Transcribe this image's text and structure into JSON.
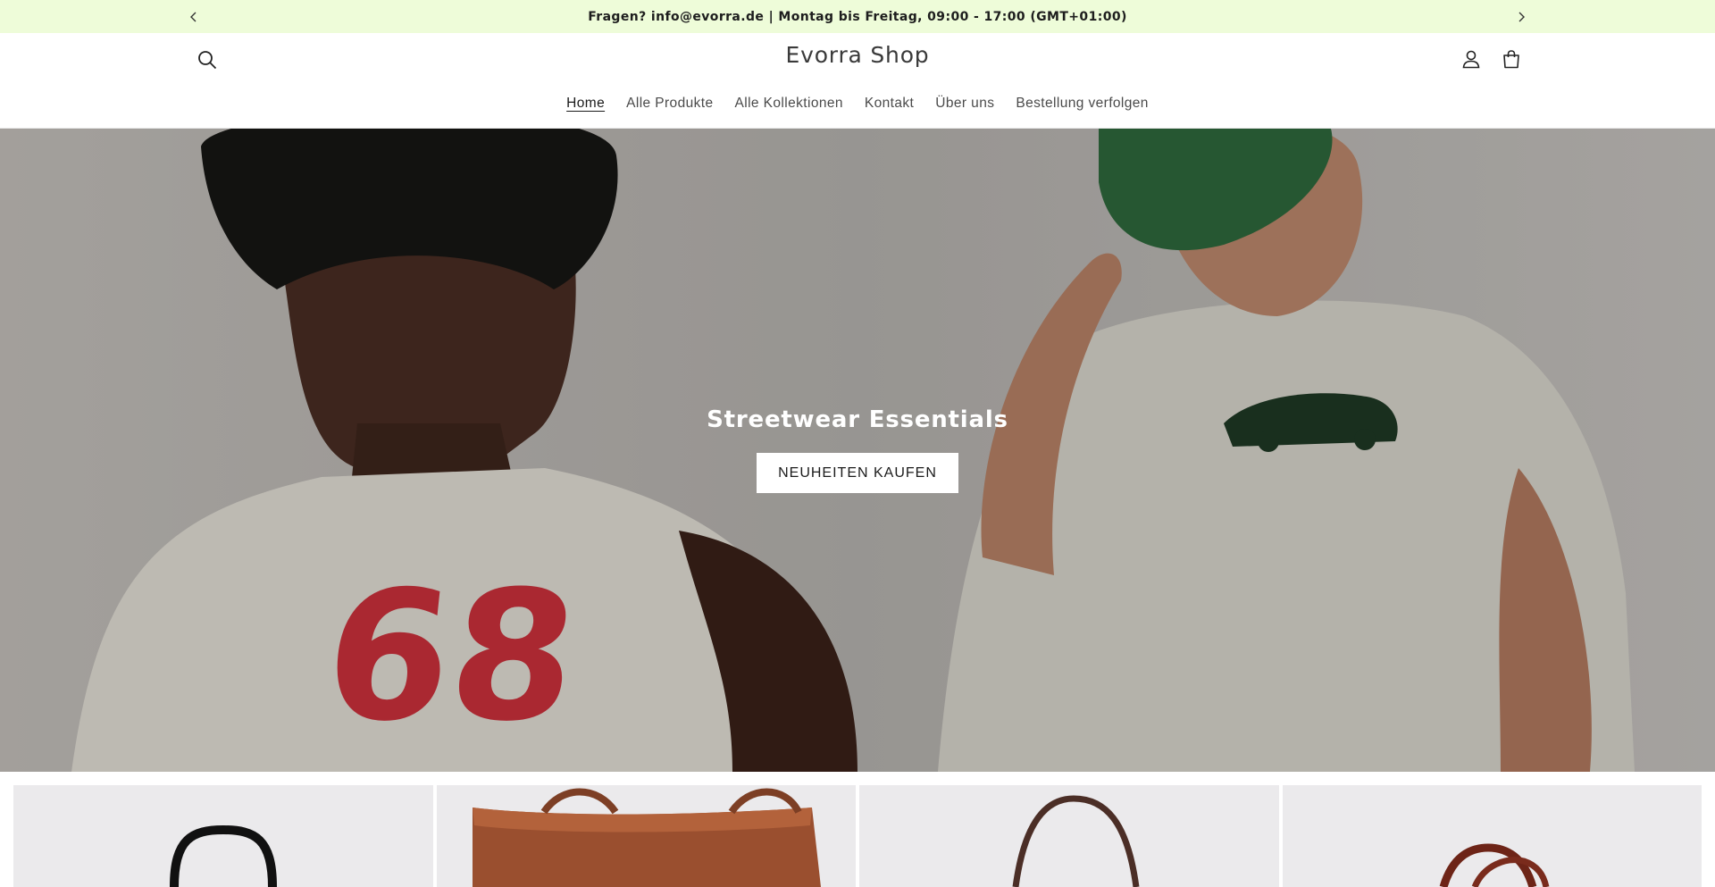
{
  "announcement": {
    "text": "Fragen? info@evorra.de | Montag bis Freitag, 09:00 - 17:00 (GMT+01:00)",
    "prev_icon": "chevron-left-icon",
    "next_icon": "chevron-right-icon"
  },
  "header": {
    "logo": "Evorra Shop",
    "search_icon": "search-icon",
    "account_icon": "account-icon",
    "cart_icon": "cart-icon"
  },
  "nav": {
    "items": [
      {
        "label": "Home",
        "active": true
      },
      {
        "label": "Alle Produkte",
        "active": false
      },
      {
        "label": "Alle Kollektionen",
        "active": false
      },
      {
        "label": "Kontakt",
        "active": false
      },
      {
        "label": "Über uns",
        "active": false
      },
      {
        "label": "Bestellung verfolgen",
        "active": false
      }
    ]
  },
  "hero": {
    "title": "Streetwear Essentials",
    "button_label": "NEUHEITEN KAUFEN",
    "left_shirt_print": "68"
  },
  "products": [
    {
      "name": "product-card-black-bag"
    },
    {
      "name": "product-card-brown-leather-tote"
    },
    {
      "name": "product-card-dark-brown-bag"
    },
    {
      "name": "product-card-burgundy-bag"
    }
  ],
  "colors": {
    "announcement_bg": "#eefcd9",
    "cta_bg": "#ffffff",
    "text": "#222222"
  }
}
